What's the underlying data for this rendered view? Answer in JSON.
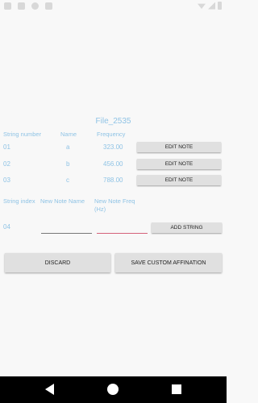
{
  "title": "File_2535",
  "headers": {
    "string_number": "String number",
    "name": "Name",
    "frequency": "Frequency"
  },
  "strings": [
    {
      "number": "01",
      "name": "a",
      "frequency": "323.00",
      "button": "EDIT NOTE"
    },
    {
      "number": "02",
      "name": "b",
      "frequency": "456.00",
      "button": "EDIT NOTE"
    },
    {
      "number": "03",
      "name": "c",
      "frequency": "788.00",
      "button": "EDIT NOTE"
    }
  ],
  "new_string": {
    "index_label": "String index",
    "name_label": "New Note Name",
    "freq_label": "New Note Freq (Hz)",
    "index": "04",
    "name_value": "",
    "freq_value": "",
    "add_button": "ADD STRING"
  },
  "actions": {
    "discard": "DISCARD",
    "save": "SAVE CUSTOM AFFINATION"
  },
  "colors": {
    "label": "#8fc3e5",
    "input_underline": "#777777",
    "input_focus": "#d4627a"
  },
  "icons": {
    "back": "back-triangle-icon",
    "home": "home-circle-icon",
    "recent": "recent-apps-square-icon"
  }
}
